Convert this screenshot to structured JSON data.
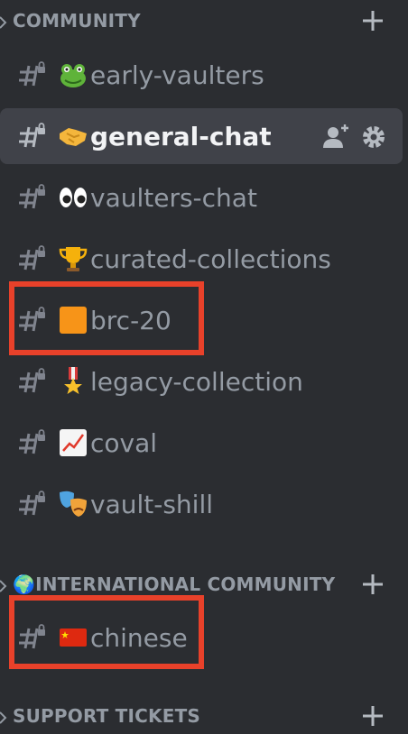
{
  "categories": [
    {
      "label": "COMMUNITY"
    },
    {
      "label": "🌍INTERNATIONAL COMMUNITY"
    },
    {
      "label": "SUPPORT TICKETS"
    }
  ],
  "channels": [
    {
      "label": "early-vaulters",
      "emoji": "frog"
    },
    {
      "label": "general-chat",
      "emoji": "handshake"
    },
    {
      "label": "vaulters-chat",
      "emoji": "eyes"
    },
    {
      "label": "curated-collections",
      "emoji": "trophy"
    },
    {
      "label": "brc-20",
      "emoji": "orange-square"
    },
    {
      "label": "legacy-collection",
      "emoji": "military-medal"
    },
    {
      "label": "coval",
      "emoji": "chart-increasing"
    },
    {
      "label": "vault-shill",
      "emoji": "performing-arts"
    },
    {
      "label": "chinese",
      "emoji": "china-flag"
    }
  ],
  "colors": {
    "background": "#2b2d31",
    "active_row": "#404249",
    "muted_text": "#949ba4",
    "active_text": "#f2f3f5",
    "highlight": "#e8412a"
  }
}
